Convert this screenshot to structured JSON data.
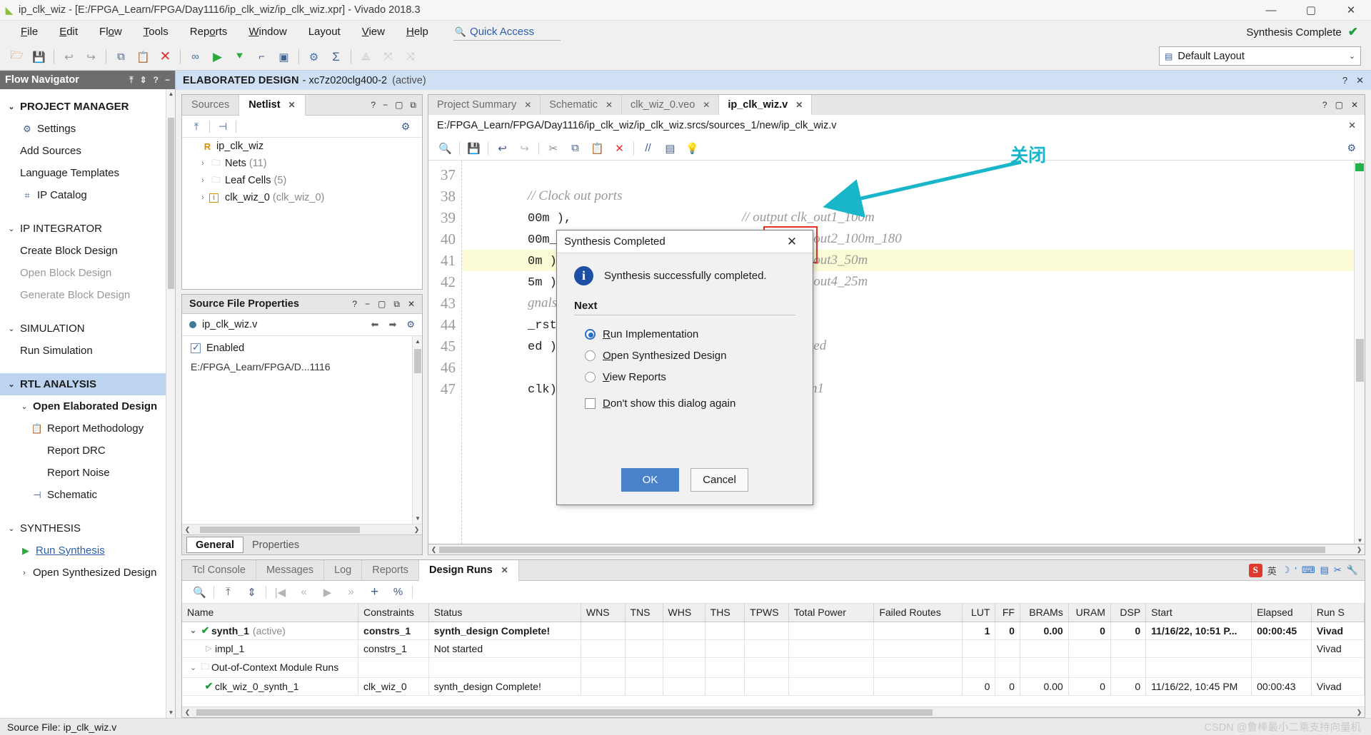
{
  "window": {
    "title": "ip_clk_wiz - [E:/FPGA_Learn/FPGA/Day1116/ip_clk_wiz/ip_clk_wiz.xpr] - Vivado 2018.3",
    "minimize": "—",
    "maximize": "▢",
    "close": "✕"
  },
  "menubar": {
    "items": [
      "File",
      "Edit",
      "Flow",
      "Tools",
      "Reports",
      "Window",
      "Layout",
      "View",
      "Help"
    ],
    "quick_access": "Quick Access",
    "status_label": "Synthesis Complete",
    "status_check": "✔"
  },
  "toolbar": {
    "layout_label": "Default Layout",
    "layout_arrow": "⌄"
  },
  "flow_navigator": {
    "title": "Flow Navigator",
    "sections": [
      {
        "label": "PROJECT MANAGER",
        "items": [
          "Settings",
          "Add Sources",
          "Language Templates",
          "IP Catalog"
        ]
      },
      {
        "label": "IP INTEGRATOR",
        "items": [
          "Create Block Design",
          "Open Block Design",
          "Generate Block Design"
        ]
      },
      {
        "label": "SIMULATION",
        "items": [
          "Run Simulation"
        ]
      },
      {
        "label": "RTL ANALYSIS",
        "items": [
          "Open Elaborated Design",
          "Report Methodology",
          "Report DRC",
          "Report Noise",
          "Schematic"
        ]
      },
      {
        "label": "SYNTHESIS",
        "items": [
          "Run Synthesis",
          "Open Synthesized Design"
        ]
      }
    ]
  },
  "elaborated_bar": {
    "title": "ELABORATED DESIGN",
    "part": "- xc7z020clg400-2",
    "active": "(active)"
  },
  "netlist_panel": {
    "tabs": [
      {
        "label": "Sources",
        "active": false,
        "closable": false
      },
      {
        "label": "Netlist",
        "active": true,
        "closable": true
      }
    ],
    "tree": [
      {
        "label": "ip_clk_wiz",
        "icon": "R",
        "suffix": ""
      },
      {
        "label": "Nets",
        "icon": "folder",
        "suffix": "(11)"
      },
      {
        "label": "Leaf Cells",
        "icon": "folder",
        "suffix": "(5)"
      },
      {
        "label": "clk_wiz_0",
        "icon": "I",
        "suffix": "(clk_wiz_0)"
      }
    ]
  },
  "properties_panel": {
    "title": "Source File Properties",
    "file": "ip_clk_wiz.v",
    "enabled_label": "Enabled",
    "enabled_checked": true,
    "location_row": "E:/FPGA_Learn/FPGA/D...1116",
    "tabs": [
      {
        "label": "General",
        "active": true
      },
      {
        "label": "Properties",
        "active": false
      }
    ]
  },
  "editor": {
    "tabs": [
      {
        "label": "Project Summary",
        "active": false
      },
      {
        "label": "Schematic",
        "active": false
      },
      {
        "label": "clk_wiz_0.veo",
        "active": false
      },
      {
        "label": "ip_clk_wiz.v",
        "active": true
      }
    ],
    "path": "E:/FPGA_Learn/FPGA/Day1116/ip_clk_wiz/ip_clk_wiz.srcs/sources_1/new/ip_clk_wiz.v",
    "lines": [
      {
        "no": "37",
        "code": "",
        "comment": "// Clock out ports",
        "highlight": false
      },
      {
        "no": "38",
        "code": "00m ),",
        "comment": "// output clk_out1_100m",
        "highlight": false
      },
      {
        "no": "39",
        "code": "00m_180deg ),",
        "comment": "// output clk_out2_100m_180",
        "highlight": false
      },
      {
        "no": "40",
        "code": "0m ),",
        "comment": "// output clk_out3_50m",
        "highlight": false
      },
      {
        "no": "41",
        "code": "5m ),",
        "comment": "// output clk_out4_25m",
        "highlight": true
      },
      {
        "no": "42",
        "code": "",
        "comment": "gnals",
        "highlight": false
      },
      {
        "no": "43",
        "code": "_rst_n ),",
        "comment": "// input reset",
        "highlight": false
      },
      {
        "no": "44",
        "code": "ed ),",
        "comment": "// output locked",
        "highlight": false
      },
      {
        "no": "45",
        "code": "",
        "comment": "",
        "highlight": false
      },
      {
        "no": "46",
        "code": "clk)",
        "comment": "// input clk_in1",
        "highlight": false
      },
      {
        "no": "47",
        "code": "",
        "comment": "",
        "highlight": false
      }
    ]
  },
  "annotation": {
    "text": "关闭"
  },
  "dialog": {
    "title": "Synthesis Completed",
    "close": "✕",
    "message": "Synthesis successfully completed.",
    "next_label": "Next",
    "options": [
      {
        "label": "Run Implementation",
        "accel": "R",
        "selected": true
      },
      {
        "label": "Open Synthesized Design",
        "accel": "O",
        "selected": false
      },
      {
        "label": "View Reports",
        "accel": "V",
        "selected": false
      }
    ],
    "dont_show_label": "Don't show this dialog again",
    "dont_show_accel": "D",
    "dont_show_checked": false,
    "ok_label": "OK",
    "cancel_label": "Cancel"
  },
  "bottom_panel": {
    "tabs": [
      {
        "label": "Tcl Console",
        "active": false,
        "closable": false
      },
      {
        "label": "Messages",
        "active": false,
        "closable": false
      },
      {
        "label": "Log",
        "active": false,
        "closable": false
      },
      {
        "label": "Reports",
        "active": false,
        "closable": false
      },
      {
        "label": "Design Runs",
        "active": true,
        "closable": true
      }
    ],
    "ime": {
      "badge": "S",
      "lang": "英",
      "items": [
        "☽",
        "'",
        "⌨",
        "📋",
        "✂",
        "🔧"
      ]
    },
    "table": {
      "headers": [
        "Name",
        "Constraints",
        "Status",
        "WNS",
        "TNS",
        "WHS",
        "THS",
        "TPWS",
        "Total Power",
        "Failed Routes",
        "LUT",
        "FF",
        "BRAMs",
        "URAM",
        "DSP",
        "Start",
        "Elapsed",
        "Run S"
      ],
      "rows": [
        {
          "name": "synth_1",
          "suffix": "(active)",
          "indent": 0,
          "icon": "check",
          "caret": "⌄",
          "bold": true,
          "constraints": "constrs_1",
          "status": "synth_design Complete!",
          "wns": "",
          "tns": "",
          "whs": "",
          "ths": "",
          "tpws": "",
          "total_power": "",
          "failed_routes": "",
          "lut": "1",
          "ff": "0",
          "brams": "0.00",
          "uram": "0",
          "dsp": "0",
          "start": "11/16/22, 10:51 P...",
          "elapsed": "00:00:45",
          "run_s": "Vivad"
        },
        {
          "name": "impl_1",
          "suffix": "",
          "indent": 1,
          "icon": "tri",
          "caret": "",
          "bold": false,
          "constraints": "constrs_1",
          "status": "Not started",
          "wns": "",
          "tns": "",
          "whs": "",
          "ths": "",
          "tpws": "",
          "total_power": "",
          "failed_routes": "",
          "lut": "",
          "ff": "",
          "brams": "",
          "uram": "",
          "dsp": "",
          "start": "",
          "elapsed": "",
          "run_s": "Vivad"
        },
        {
          "name": "Out-of-Context Module Runs",
          "suffix": "",
          "indent": 0,
          "icon": "folder",
          "caret": "⌄",
          "bold": false,
          "constraints": "",
          "status": "",
          "wns": "",
          "tns": "",
          "whs": "",
          "ths": "",
          "tpws": "",
          "total_power": "",
          "failed_routes": "",
          "lut": "",
          "ff": "",
          "brams": "",
          "uram": "",
          "dsp": "",
          "start": "",
          "elapsed": "",
          "run_s": ""
        },
        {
          "name": "clk_wiz_0_synth_1",
          "suffix": "",
          "indent": 1,
          "icon": "check",
          "caret": "",
          "bold": false,
          "constraints": "clk_wiz_0",
          "status": "synth_design Complete!",
          "wns": "",
          "tns": "",
          "whs": "",
          "ths": "",
          "tpws": "",
          "total_power": "",
          "failed_routes": "",
          "lut": "0",
          "ff": "0",
          "brams": "0.00",
          "uram": "0",
          "dsp": "0",
          "start": "11/16/22, 10:45 PM",
          "elapsed": "00:00:43",
          "run_s": "Vivad"
        }
      ]
    }
  },
  "statusbar": {
    "text": "Source File: ip_clk_wiz.v",
    "watermark": "CSDN @鲁棒最小二乘支持向量机"
  }
}
